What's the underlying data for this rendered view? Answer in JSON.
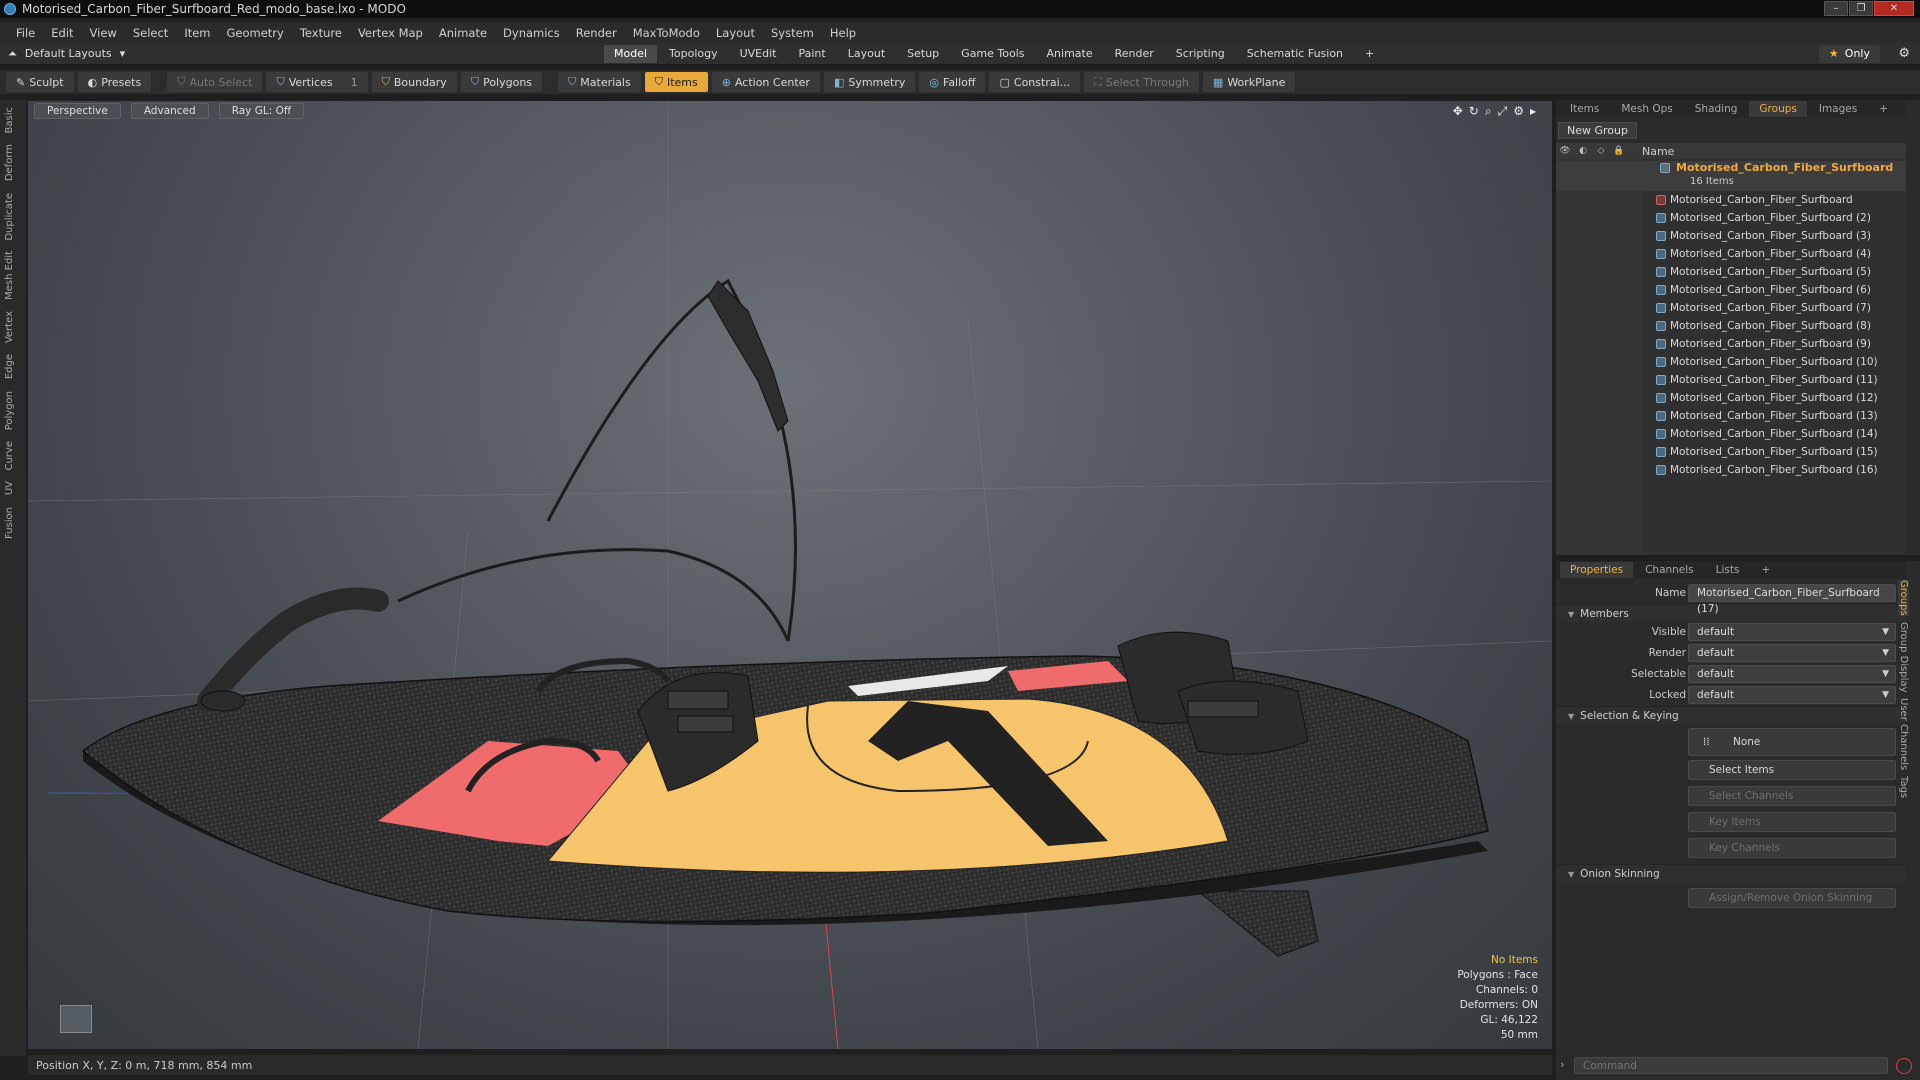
{
  "window": {
    "title": "Motorised_Carbon_Fiber_Surfboard_Red_modo_base.lxo - MODO"
  },
  "menu": [
    "File",
    "Edit",
    "View",
    "Select",
    "Item",
    "Geometry",
    "Texture",
    "Vertex Map",
    "Animate",
    "Dynamics",
    "Render",
    "MaxToModo",
    "Layout",
    "System",
    "Help"
  ],
  "layouts": {
    "label": "Default Layouts"
  },
  "tabs": [
    "Model",
    "Topology",
    "UVEdit",
    "Paint",
    "Layout",
    "Setup",
    "Game Tools",
    "Animate",
    "Render",
    "Scripting",
    "Schematic Fusion"
  ],
  "only_label": "Only",
  "toolbar": {
    "sculpt": "Sculpt",
    "presets": "Presets",
    "auto_select": "Auto Select",
    "vertices": "Vertices",
    "vertices_count": "1",
    "boundary": "Boundary",
    "polygons": "Polygons",
    "materials": "Materials",
    "items": "Items",
    "action_center": "Action Center",
    "symmetry": "Symmetry",
    "falloff": "Falloff",
    "constrain": "Constrai...",
    "select_through": "Select Through",
    "workplane": "WorkPlane"
  },
  "left_tabs": [
    "Basic",
    "Deform",
    "Duplicate",
    "Mesh Edit",
    "Vertex",
    "Edge",
    "Polygon",
    "Curve",
    "UV",
    "Fusion"
  ],
  "viewport": {
    "view": "Perspective",
    "shading": "Advanced",
    "raygl": "Ray GL: Off",
    "info": {
      "no_items": "No Items",
      "polygons": "Polygons : Face",
      "channels": "Channels: 0",
      "deformers": "Deformers: ON",
      "gl": "GL: 46,122",
      "size": "50 mm"
    }
  },
  "status": "Position X, Y, Z:  0 m, 718 mm, 854 mm",
  "right_tabs": [
    "Items",
    "Mesh Ops",
    "Shading",
    "Groups",
    "Images"
  ],
  "groups": {
    "new_group": "New Group",
    "col_name": "Name",
    "parent": {
      "name": "Motorised_Carbon_Fiber_Surfboard",
      "count": "16 Items"
    },
    "items": [
      "Motorised_Carbon_Fiber_Surfboard",
      "Motorised_Carbon_Fiber_Surfboard (2)",
      "Motorised_Carbon_Fiber_Surfboard (3)",
      "Motorised_Carbon_Fiber_Surfboard (4)",
      "Motorised_Carbon_Fiber_Surfboard (5)",
      "Motorised_Carbon_Fiber_Surfboard (6)",
      "Motorised_Carbon_Fiber_Surfboard (7)",
      "Motorised_Carbon_Fiber_Surfboard (8)",
      "Motorised_Carbon_Fiber_Surfboard (9)",
      "Motorised_Carbon_Fiber_Surfboard (10)",
      "Motorised_Carbon_Fiber_Surfboard (11)",
      "Motorised_Carbon_Fiber_Surfboard (12)",
      "Motorised_Carbon_Fiber_Surfboard (13)",
      "Motorised_Carbon_Fiber_Surfboard (14)",
      "Motorised_Carbon_Fiber_Surfboard (15)",
      "Motorised_Carbon_Fiber_Surfboard (16)"
    ]
  },
  "props_tabs": [
    "Properties",
    "Channels",
    "Lists"
  ],
  "properties": {
    "name_label": "Name",
    "name_value": "Motorised_Carbon_Fiber_Surfboard (17)",
    "members": "Members",
    "visible_label": "Visible",
    "visible_value": "default",
    "render_label": "Render",
    "render_value": "default",
    "selectable_label": "Selectable",
    "selectable_value": "default",
    "locked_label": "Locked",
    "locked_value": "default",
    "selection_keying": "Selection & Keying",
    "none": "None",
    "select_items": "Select Items",
    "select_channels": "Select Channels",
    "key_items": "Key Items",
    "key_channels": "Key Channels",
    "onion": "Onion Skinning",
    "assign_onion": "Assign/Remove Onion Skinning"
  },
  "side_vtabs": [
    "Groups",
    "Group Display",
    "User Channels",
    "Tags"
  ],
  "command": {
    "placeholder": "Command"
  },
  "colors": {
    "accent": "#f0b342",
    "items_active": "#e9a93a",
    "board_yellow": "#f6c46a",
    "board_red": "#f06b6b"
  }
}
